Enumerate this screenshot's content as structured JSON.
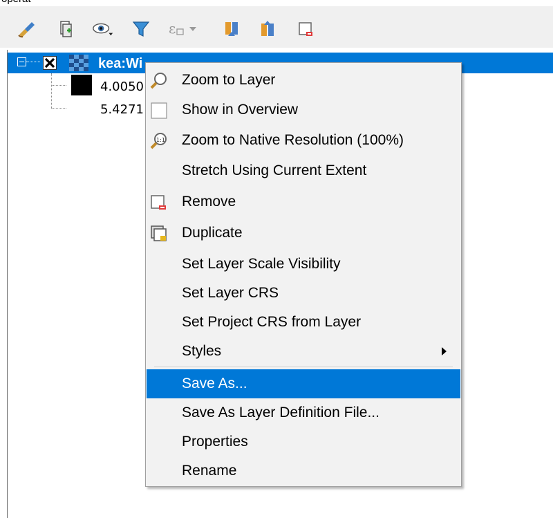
{
  "top_clip": "operat",
  "layer": {
    "name": "kea:Wi",
    "legend_values": [
      "4.0050",
      "5.4271"
    ]
  },
  "toolbar": {
    "icons": [
      "style-brush-icon",
      "add-group-icon",
      "visibility-eye-icon",
      "filter-icon",
      "expression-filter-icon",
      "expand-all-icon",
      "collapse-all-icon",
      "remove-layer-icon"
    ]
  },
  "context_menu": {
    "items": [
      {
        "label": "Zoom to Layer",
        "icon": "zoom-magnifier-icon"
      },
      {
        "label": "Show in Overview",
        "icon": "checkbox-icon"
      },
      {
        "label": "Zoom to Native Resolution (100%)",
        "icon": "zoom-native-icon"
      },
      {
        "label": "Stretch Using Current Extent",
        "icon": ""
      },
      {
        "label": "Remove",
        "icon": "remove-layer-icon"
      },
      {
        "label": "Duplicate",
        "icon": "duplicate-layer-icon"
      },
      {
        "label": "Set Layer Scale Visibility",
        "icon": ""
      },
      {
        "label": "Set Layer CRS",
        "icon": ""
      },
      {
        "label": "Set Project CRS from Layer",
        "icon": ""
      },
      {
        "label": "Styles",
        "icon": "",
        "submenu": true
      },
      {
        "label": "Save As...",
        "icon": "",
        "highlighted": true
      },
      {
        "label": "Save As Layer Definition File...",
        "icon": ""
      },
      {
        "label": "Properties",
        "icon": ""
      },
      {
        "label": "Rename",
        "icon": ""
      }
    ]
  },
  "colors": {
    "selection": "#0078d7",
    "toolbar_bg": "#f0f0f0",
    "menu_bg": "#f2f2f2"
  }
}
